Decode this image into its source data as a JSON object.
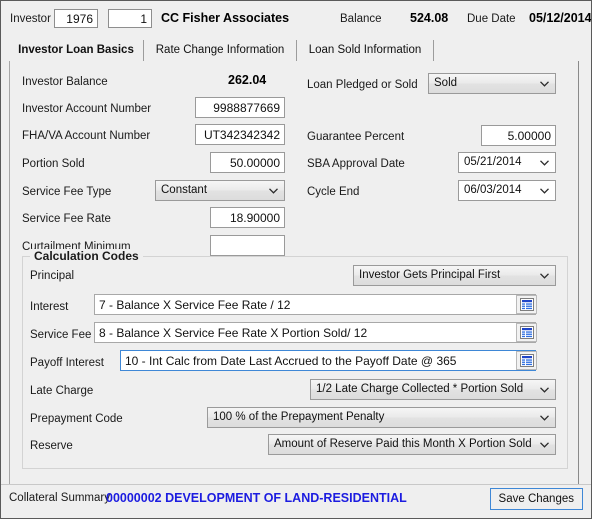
{
  "window": {
    "accent_focus": "#3e87d6",
    "background": "#efefef"
  },
  "header": {
    "investor_label": "Investor",
    "investor_number": "1976",
    "investor_seq": "1",
    "investor_name": "CC Fisher Associates",
    "balance_label": "Balance",
    "balance_value": "524.08",
    "due_date_label": "Due Date",
    "due_date_value": "05/12/2014"
  },
  "tabs": [
    {
      "label": "Investor Loan Basics",
      "active": true
    },
    {
      "label": "Rate Change Information",
      "active": false
    },
    {
      "label": "Loan Sold Information",
      "active": false
    }
  ],
  "left_column": {
    "investor_balance_label": "Investor Balance",
    "investor_balance_value": "262.04",
    "investor_account_label": "Investor Account Number",
    "investor_account_value": "9988877669",
    "fha_va_label": "FHA/VA Account Number",
    "fha_va_value": "UT342342342",
    "portion_sold_label": "Portion Sold",
    "portion_sold_value": "50.00000",
    "service_fee_type_label": "Service Fee Type",
    "service_fee_type_value": "Constant",
    "service_fee_rate_label": "Service Fee Rate",
    "service_fee_rate_value": "18.90000",
    "curtailment_minimum_label": "Curtailment Minimum",
    "curtailment_minimum_value": ""
  },
  "right_column": {
    "loan_pledged_label": "Loan Pledged or Sold",
    "loan_pledged_value": "Sold",
    "guarantee_percent_label": "Guarantee Percent",
    "guarantee_percent_value": "5.00000",
    "sba_approval_label": "SBA Approval Date",
    "sba_approval_value": "05/21/2014",
    "cycle_end_label": "Cycle End",
    "cycle_end_value": "06/03/2014"
  },
  "calculation_codes": {
    "title": "Calculation Codes",
    "principal_label": "Principal",
    "principal_value": "Investor Gets Principal First",
    "interest_label": "Interest",
    "interest_value": "7 - Balance X Service Fee Rate / 12",
    "service_fee_label": "Service Fee",
    "service_fee_value": "8 - Balance X Service Fee Rate X Portion Sold/ 12",
    "payoff_interest_label": "Payoff Interest",
    "payoff_interest_value": "10 - Int Calc from Date Last Accrued to the Payoff Date @ 365",
    "late_charge_label": "Late Charge",
    "late_charge_value": "1/2 Late Charge Collected * Portion Sold",
    "prepayment_code_label": "Prepayment Code",
    "prepayment_code_value": "100 % of the Prepayment Penalty",
    "reserve_label": "Reserve",
    "reserve_value": "Amount of Reserve Paid this Month X Portion Sold"
  },
  "status_bar": {
    "label": "Collateral Summary",
    "value": "00000002 DEVELOPMENT OF LAND-RESIDENTIAL",
    "value_color": "#1c1ce0",
    "save_label": "Save Changes"
  }
}
